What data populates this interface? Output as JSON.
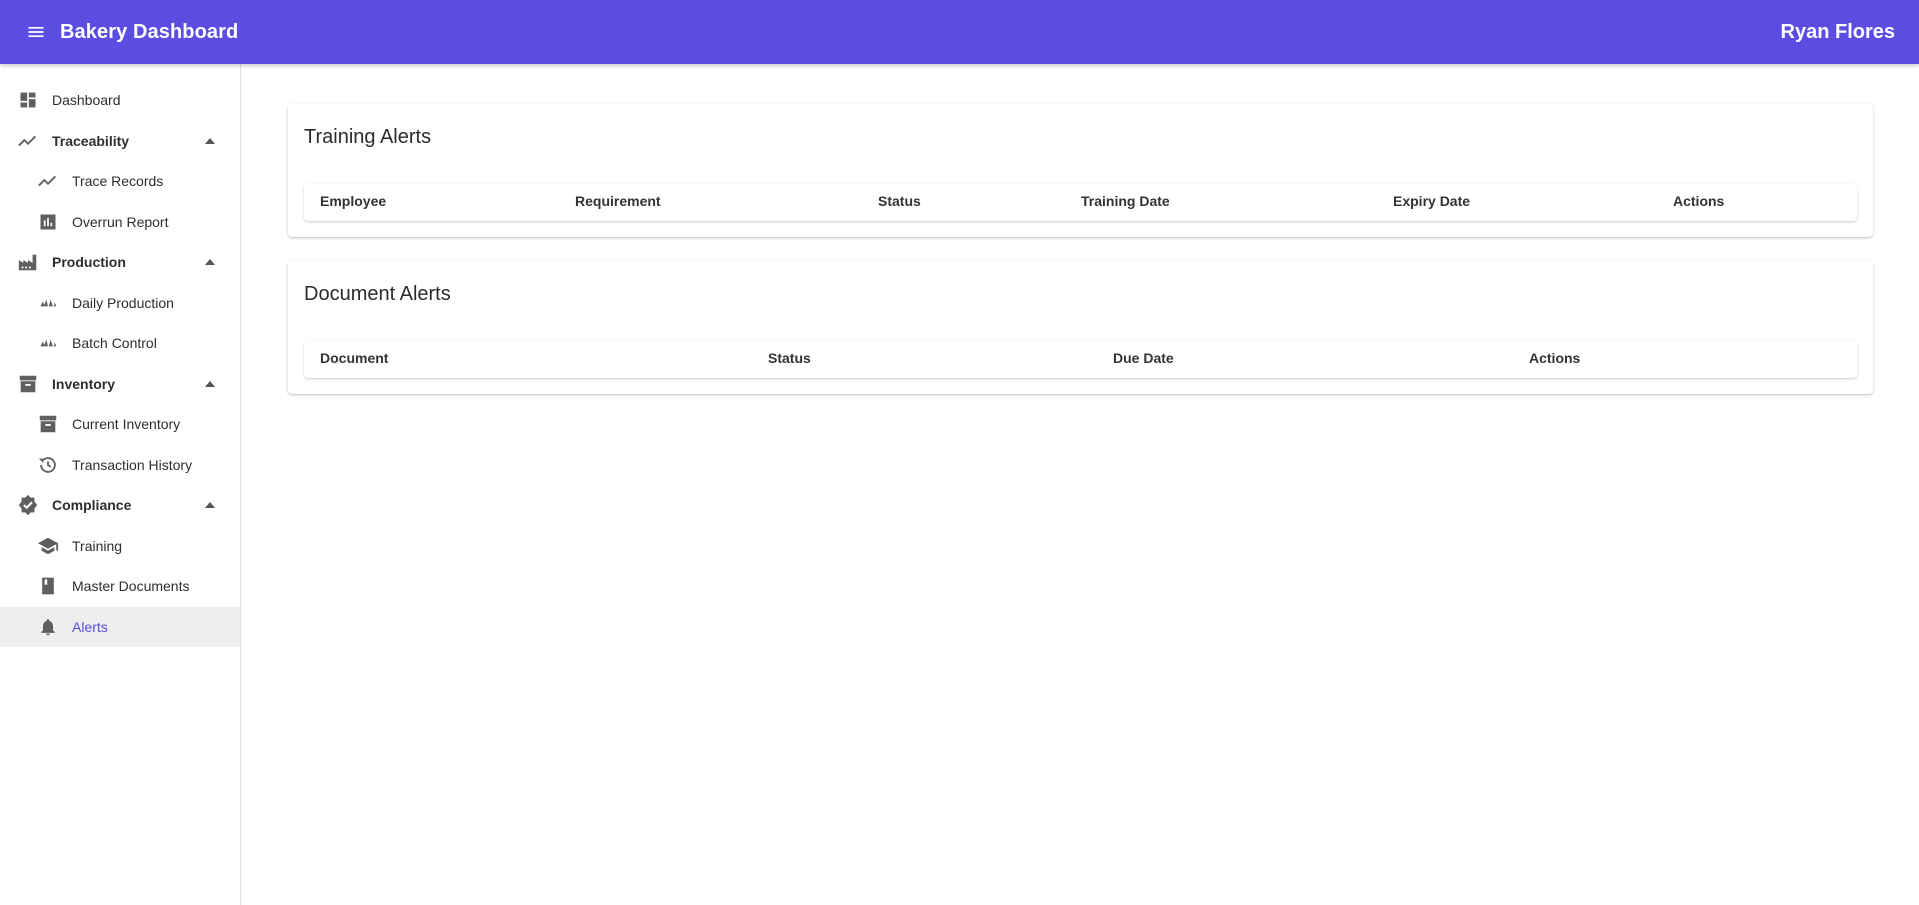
{
  "appbar": {
    "title": "Bakery Dashboard",
    "user": "Ryan Flores",
    "accent_color": "#5b4de2",
    "menu_icon": "menu-icon"
  },
  "sidebar": {
    "items": [
      {
        "label": "Dashboard",
        "icon": "dashboard-icon"
      },
      {
        "label": "Traceability",
        "icon": "trending-icon",
        "expanded": true
      },
      {
        "label": "Trace Records",
        "icon": "trending-icon"
      },
      {
        "label": "Overrun Report",
        "icon": "bar-chart-icon"
      },
      {
        "label": "Production",
        "icon": "factory-icon",
        "expanded": true
      },
      {
        "label": "Daily Production",
        "icon": "bakery-icon"
      },
      {
        "label": "Batch Control",
        "icon": "bakery-icon"
      },
      {
        "label": "Inventory",
        "icon": "archive-icon",
        "expanded": true
      },
      {
        "label": "Current Inventory",
        "icon": "archive-icon"
      },
      {
        "label": "Transaction History",
        "icon": "history-icon"
      },
      {
        "label": "Compliance",
        "icon": "verified-icon",
        "expanded": true
      },
      {
        "label": "Training",
        "icon": "school-icon"
      },
      {
        "label": "Master Documents",
        "icon": "book-icon"
      },
      {
        "label": "Alerts",
        "icon": "bell-icon",
        "active": true
      }
    ]
  },
  "training_alerts": {
    "title": "Training Alerts",
    "columns": [
      "Employee",
      "Requirement",
      "Status",
      "Training Date",
      "Expiry Date",
      "Actions"
    ],
    "rows": []
  },
  "document_alerts": {
    "title": "Document Alerts",
    "columns": [
      "Document",
      "Status",
      "Due Date",
      "Actions"
    ],
    "rows": []
  }
}
